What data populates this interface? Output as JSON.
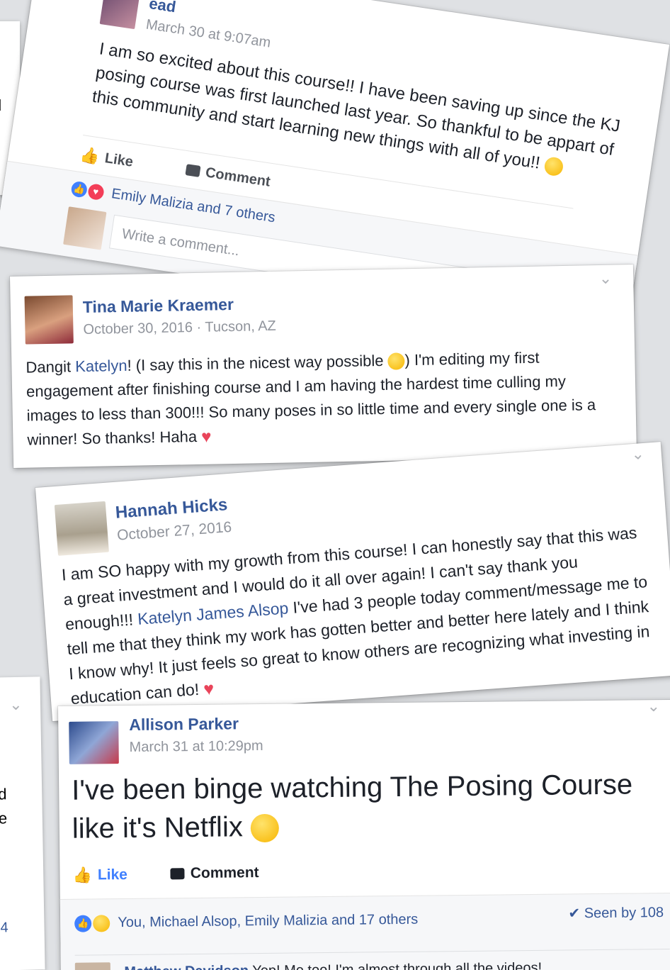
{
  "post1": {
    "author_fragment": "ead",
    "timestamp": "March 30 at 9:07am",
    "text": "I am so excited about this course!! I have been saving up since the KJ posing course was first launched last year. So thankful to be appart of this community and start learning new things with all of you!!",
    "like_label": "Like",
    "comment_label": "Comment",
    "reactions_text": "Emily Malizia and 7 others",
    "comment_placeholder": "Write a comment..."
  },
  "post2": {
    "author": "Tina Marie Kraemer",
    "timestamp": "October 30, 2016 · Tucson, AZ",
    "text_a": "Dangit ",
    "mention": "Katelyn",
    "text_b": "! (I say this in the nicest way possible ",
    "text_c": ") I'm editing my first engagement after finishing course and I am having the hardest time culling my images to less than 300!!! So many poses in so little time and every single one is a winner! So thanks! Haha"
  },
  "post3": {
    "author": "Hannah Hicks",
    "timestamp": "October 27, 2016",
    "text_a": "I am SO happy with my growth from this course! I can honestly say that this was a great investment and I would do it all over again! I can't say thank you enough!!! ",
    "mention": "Katelyn James Alsop",
    "text_b": " I've had 3 people today comment/message me to tell me that they think my work has gotten better and better here lately and I think I know why! It just feels so great to know others are recognizing what investing in education can do!"
  },
  "post4": {
    "author": "Allison Parker",
    "timestamp": "March 31 at 10:29pm",
    "text": "I've been binge watching The Posing Course like it's Netflix",
    "like_label": "Like",
    "comment_label": "Comment",
    "reactions_text": "You, Michael Alsop, Emily Malizia and 17 others",
    "seen_text": "Seen by 108",
    "reply_author": "Matthew Davidson",
    "reply_text": "Yep! Me too! I'm almost through all the videos!"
  },
  "fragments": {
    "left1_a": "t",
    "left1_b": "d",
    "left2_a": "d",
    "left2_b": "e",
    "left3": "4"
  },
  "colors": {
    "link": "#365899",
    "meta": "#90949c",
    "heart": "#e9445a",
    "like_blue": "#4080ff"
  }
}
